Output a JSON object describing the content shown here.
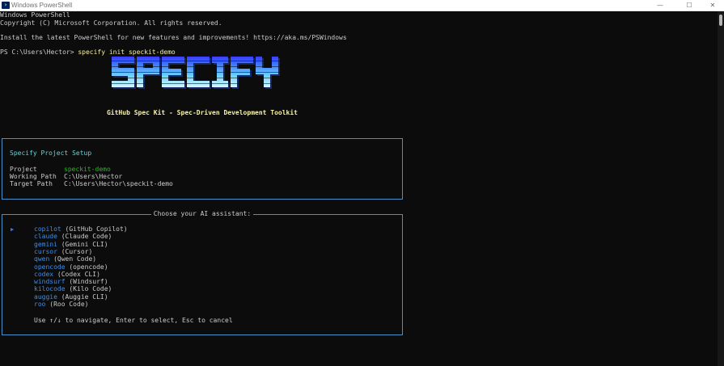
{
  "window": {
    "title": "Windows PowerShell",
    "icon": "powershell-icon",
    "controls": {
      "minimize": "—",
      "maximize": "☐",
      "close": "✕"
    }
  },
  "terminal": {
    "lines": [
      "Windows PowerShell",
      "Copyright (C) Microsoft Corporation. All rights reserved.",
      "",
      "Install the latest PowerShell for new features and improvements! https://aka.ms/PSWindows",
      ""
    ],
    "prompt": "PS C:\\Users\\Hector> ",
    "command": "specify init speckit-demo"
  },
  "banner": {
    "logo_text": "SPECIFY",
    "tagline": "GitHub Spec Kit - Spec-Driven Development Toolkit",
    "gradient": [
      "#3b3bff",
      "#3a78ff",
      "#5aa9ff",
      "#69d2ff",
      "#9fe6ff",
      "#d6f6ff"
    ]
  },
  "setup": {
    "title": "Specify Project Setup",
    "rows": [
      {
        "label": "Project",
        "value": "speckit-demo",
        "color": "#16c60c"
      },
      {
        "label": "Working Path",
        "value": "C:\\Users\\Hector",
        "color": "#cccccc"
      },
      {
        "label": "Target Path",
        "value": "C:\\Users\\Hector\\speckit-demo",
        "color": "#cccccc"
      }
    ]
  },
  "assistant": {
    "heading": "Choose your AI assistant:",
    "pointer": "▶",
    "selected_index": 0,
    "options": [
      {
        "key": "copilot",
        "desc": "(GitHub Copilot)"
      },
      {
        "key": "claude",
        "desc": "(Claude Code)"
      },
      {
        "key": "gemini",
        "desc": "(Gemini CLI)"
      },
      {
        "key": "cursor",
        "desc": "(Cursor)"
      },
      {
        "key": "qwen",
        "desc": "(Qwen Code)"
      },
      {
        "key": "opencode",
        "desc": "(opencode)"
      },
      {
        "key": "codex",
        "desc": "(Codex CLI)"
      },
      {
        "key": "windsurf",
        "desc": "(Windsurf)"
      },
      {
        "key": "kilocode",
        "desc": "(Kilo Code)"
      },
      {
        "key": "auggie",
        "desc": "(Auggie CLI)"
      },
      {
        "key": "roo",
        "desc": "(Roo Code)"
      }
    ],
    "help": "Use ↑/↓ to navigate, Enter to select, Esc to cancel"
  }
}
